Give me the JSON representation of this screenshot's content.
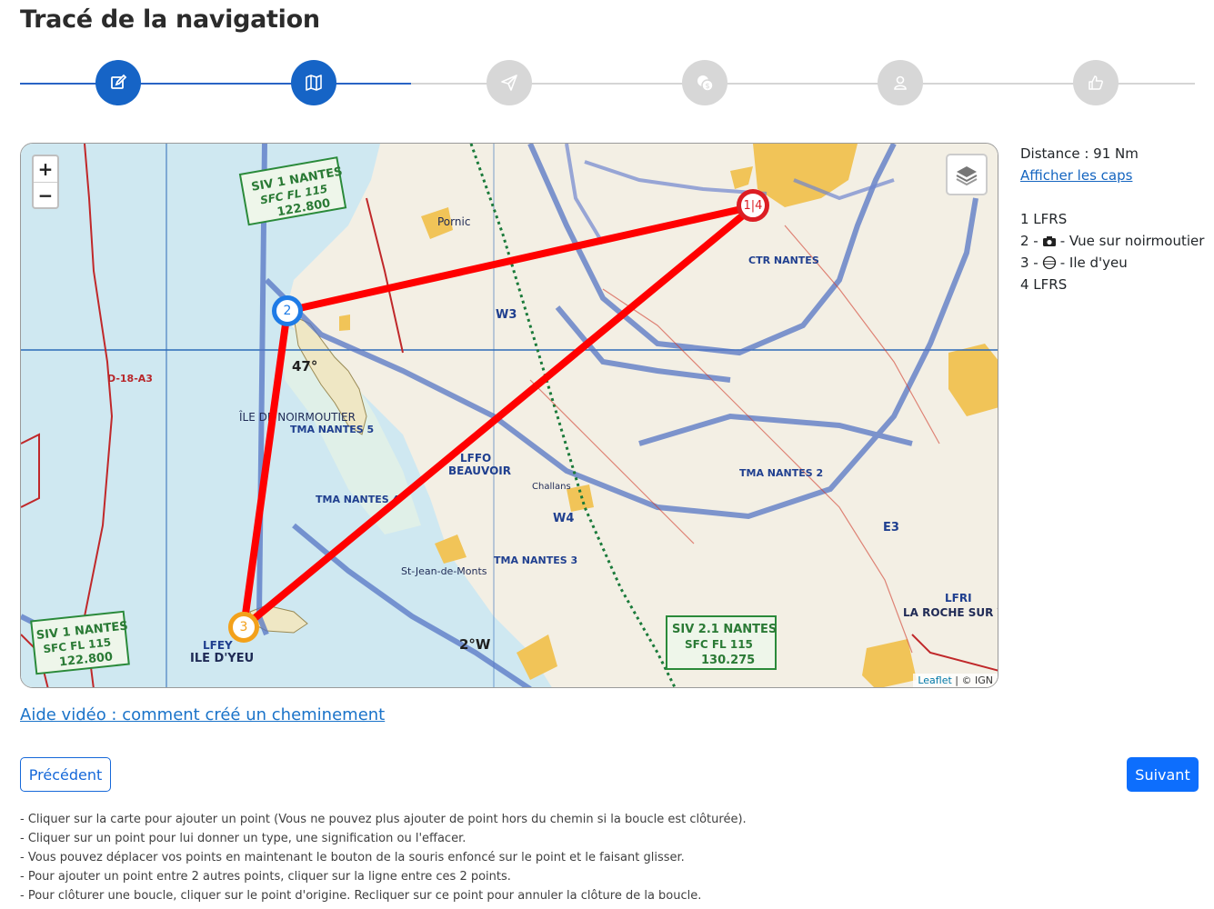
{
  "page_title": "Tracé de la navigation",
  "stepper": {
    "steps": [
      {
        "icon": "pencil-icon",
        "active": true
      },
      {
        "icon": "map-icon",
        "active": true
      },
      {
        "icon": "paper-plane-icon",
        "active": false
      },
      {
        "icon": "money-icon",
        "active": false
      },
      {
        "icon": "user-icon",
        "active": false
      },
      {
        "icon": "thumbs-up-icon",
        "active": false
      }
    ]
  },
  "map": {
    "zoom_in": "+",
    "zoom_out": "−",
    "attribution_leaflet": "Leaflet",
    "attribution_sep": " | © ",
    "attribution_ign": "IGN",
    "waypoints": [
      {
        "label": "1|4",
        "kind": "red"
      },
      {
        "label": "2",
        "kind": "blue"
      },
      {
        "label": "3",
        "kind": "orange"
      }
    ]
  },
  "side": {
    "distance": "Distance : 91 Nm",
    "show_caps": "Afficher les caps",
    "points": [
      {
        "text": "1 LFRS",
        "icon": ""
      },
      {
        "prefix": "2 - ",
        "text": " - Vue sur noirmoutier",
        "icon": "camera-icon"
      },
      {
        "prefix": "3 - ",
        "text": " - Ile d'yeu",
        "icon": "aerodrome-icon"
      },
      {
        "text": "4 LFRS",
        "icon": ""
      }
    ]
  },
  "help_link": "Aide vidéo : comment créé un cheminement",
  "buttons": {
    "previous": "Précédent",
    "next": "Suivant"
  },
  "notes": [
    "- Cliquer sur la carte pour ajouter un point (Vous ne pouvez plus ajouter de point hors du chemin si la boucle est clôturée).",
    "- Cliquer sur un point pour lui donner un type, une signification ou l'effacer.",
    "- Vous pouvez déplacer vos points en maintenant le bouton de la souris enfoncé sur le point et le faisant glisser.",
    "- Pour ajouter un point entre 2 autres points, cliquer sur la ligne entre ces 2 points.",
    "- Pour clôturer une boucle, cliquer sur le point d'origine. Recliquer sur ce point pour annuler la clôture de la boucle."
  ],
  "map_labels": {
    "siv_top": "SIV 1 NANTES",
    "siv_top_sfc": "SFC   FL 115",
    "siv_top_freq": "122.800",
    "siv_bottom_left": "SIV 1 NANTES",
    "siv_bottom_left_sfc": "SFC   FL 115",
    "siv_bottom_left_freq": "122.800",
    "siv_bottom_right": "SIV 2.1 NANTES",
    "siv_bottom_right_sfc": "SFC   FL 115",
    "siv_bottom_right_freq": "130.275",
    "tma_nantes5": "TMA NANTES 5",
    "tma_nantes4": "TMA NANTES 4",
    "tma_nantes3": "TMA NANTES 3",
    "tma_nantes2": "TMA NANTES 2",
    "ctr_nantes": "CTR NANTES",
    "noirmoutier": "ÎLE DE NOIRMOUTIER",
    "ile_yeu": "ILE D'YEU",
    "lfey": "LFEY",
    "lffo": "LFFO",
    "beauvoir": "BEAUVOIR",
    "la_roche": "LA ROCHE SUR YON",
    "lfri": "LFRI",
    "pornic": "Pornic",
    "st_jean": "St-Jean-de-Monts",
    "challans": "Challans",
    "r_d18": "D-18-A3",
    "w4": "W4",
    "w3": "W3",
    "e3": "E3",
    "deg47": "47°",
    "deg2w": "2°W"
  }
}
